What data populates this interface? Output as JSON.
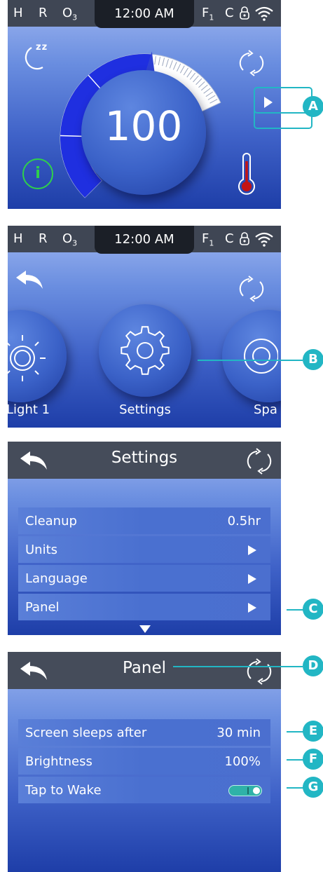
{
  "status_bar": {
    "heater": "H",
    "ready": "R",
    "ozone": "O",
    "ozone_sub": "3",
    "time": "12:00 AM",
    "filter": "F",
    "filter_sub": "1",
    "celsius": "C",
    "lock_icon": "lock-icon",
    "wifi_icon": "wifi-icon"
  },
  "screen_home": {
    "setpoint": "100",
    "sleep_icon_text": "zz",
    "info_label": "i",
    "level_fraction": 0.7
  },
  "screen_menu": {
    "items": [
      {
        "label": "Light 1",
        "icon": "sun-icon"
      },
      {
        "label": "Settings",
        "icon": "gear-icon"
      },
      {
        "label": "Spa",
        "icon": "spa-icon"
      }
    ]
  },
  "screen_settings": {
    "title": "Settings",
    "rows": [
      {
        "label": "Cleanup",
        "value": "0.5hr"
      },
      {
        "label": "Units",
        "value": ""
      },
      {
        "label": "Language",
        "value": ""
      },
      {
        "label": "Panel",
        "value": ""
      }
    ]
  },
  "screen_panel": {
    "title": "Panel",
    "rows": [
      {
        "label": "Screen sleeps after",
        "value": "30 min"
      },
      {
        "label": "Brightness",
        "value": "100%"
      },
      {
        "label": "Tap to Wake",
        "value": ""
      }
    ],
    "tap_to_wake_on": true
  },
  "callouts": {
    "a": "A",
    "b": "B",
    "c": "C",
    "d": "D",
    "e": "E",
    "f": "F",
    "g": "G"
  },
  "colors": {
    "callout": "#22b6c4",
    "status_bar": "#3f4654",
    "thermometer": "#c41414",
    "info": "#2fd14a"
  }
}
